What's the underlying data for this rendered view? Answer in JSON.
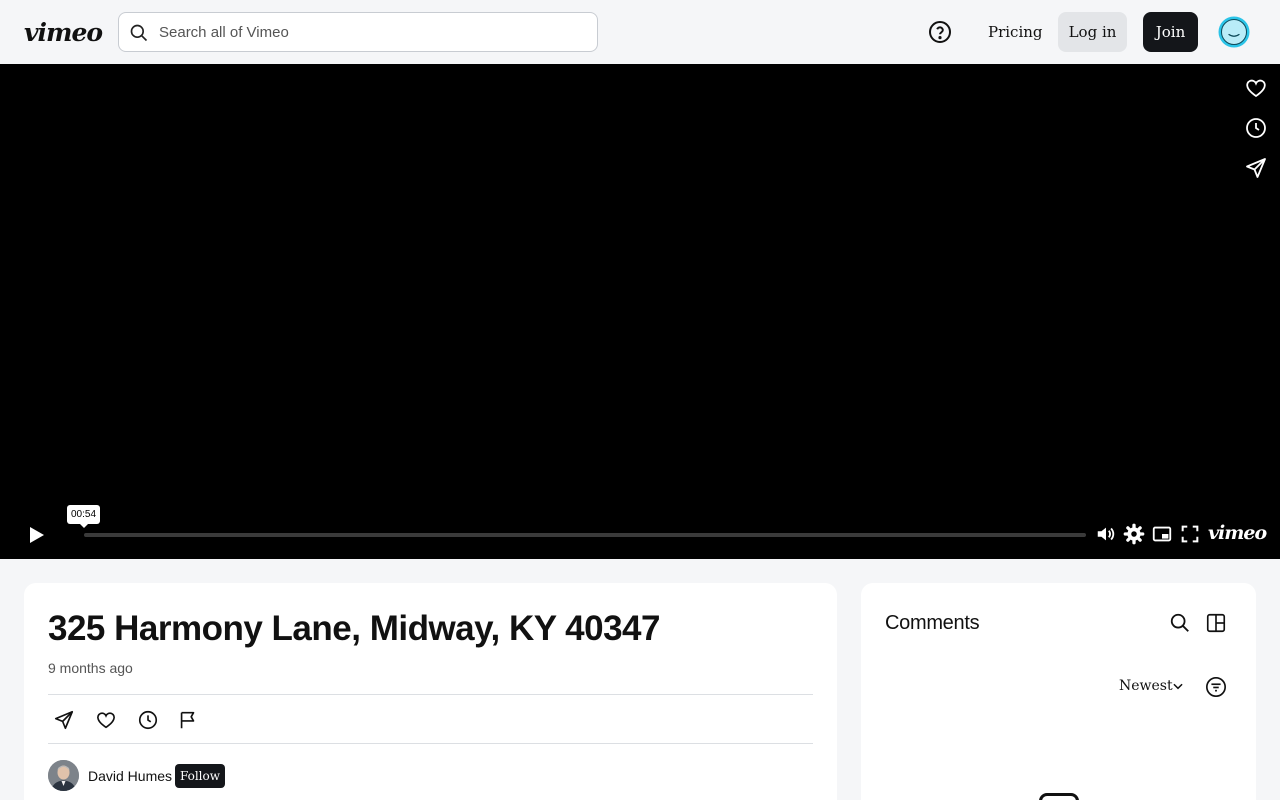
{
  "header": {
    "logo": "vimeo",
    "search_placeholder": "Search all of Vimeo",
    "pricing": "Pricing",
    "login": "Log in",
    "join": "Join"
  },
  "player": {
    "hover_time": "00:54",
    "progress_fraction": 0.0,
    "brand": "vimeo"
  },
  "video": {
    "title": "325 Harmony Lane, Midway, KY 40347",
    "age": "9 months ago",
    "author": "David Humes",
    "follow": "Follow"
  },
  "comments": {
    "title": "Comments",
    "sort": "Newest"
  },
  "colors": {
    "avatar_accent": "#2bc4e8",
    "dark_button": "#14161a"
  }
}
